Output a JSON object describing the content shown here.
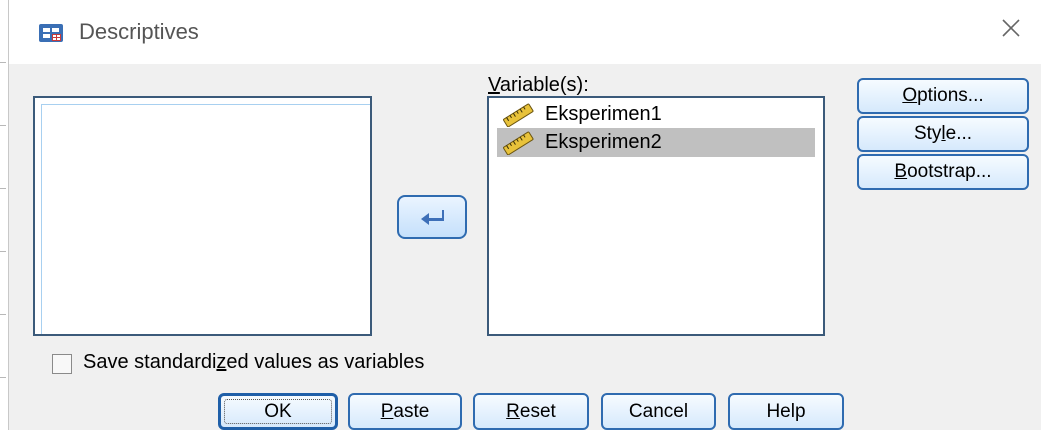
{
  "window": {
    "title": "Descriptives"
  },
  "variables_label": "Variable(s):",
  "selected_variables": [
    {
      "name": "Eksperimen1",
      "selected": false
    },
    {
      "name": "Eksperimen2",
      "selected": true
    }
  ],
  "side_buttons": {
    "options": {
      "pre": "",
      "mn": "O",
      "post": "ptions..."
    },
    "style": {
      "pre": "Sty",
      "mn": "l",
      "post": "e..."
    },
    "bootstrap": {
      "pre": "",
      "mn": "B",
      "post": "ootstrap..."
    }
  },
  "save_option": {
    "pre": "Save standardi",
    "mn": "z",
    "post": "ed values as variables",
    "checked": false
  },
  "bottom_buttons": {
    "ok": "OK",
    "paste": {
      "mn": "P",
      "post": "aste"
    },
    "reset": {
      "mn": "R",
      "post": "eset"
    },
    "cancel": "Cancel",
    "help": "Help"
  },
  "icons": {
    "app": "spss-data-table-icon",
    "close": "close-icon",
    "arrow": "arrow-left-icon",
    "variable": "ruler-scale-icon"
  }
}
